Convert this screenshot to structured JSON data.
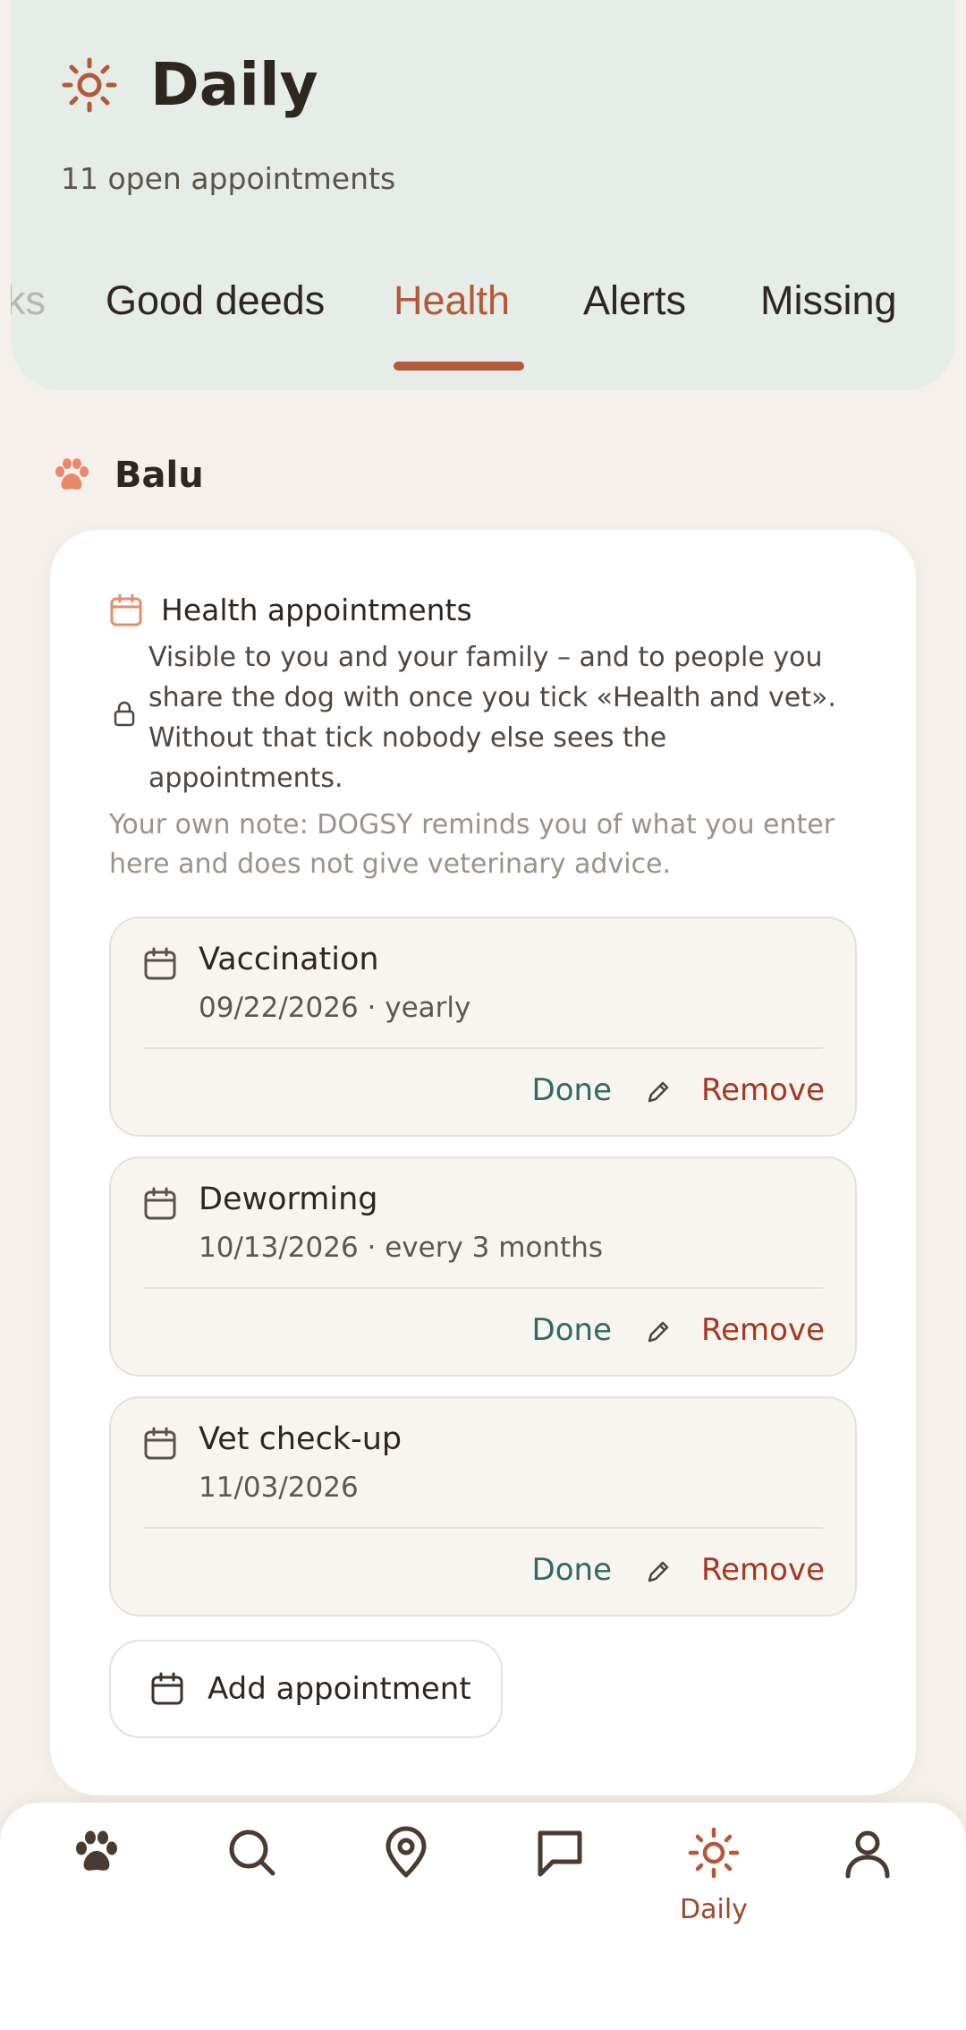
{
  "header": {
    "title": "Daily",
    "subtitle": "11 open appointments"
  },
  "tabs": [
    {
      "label": "ks",
      "state": "faded"
    },
    {
      "label": "Good deeds",
      "state": "normal"
    },
    {
      "label": "Health",
      "state": "active"
    },
    {
      "label": "Alerts",
      "state": "normal"
    },
    {
      "label": "Missing",
      "state": "normal"
    }
  ],
  "dog": {
    "name": "Balu"
  },
  "card": {
    "title": "Health appointments",
    "visibility_text": "Visible to you and your family – and to people you share the dog with once you tick «Health and vet». Without that tick nobody else sees the appointments.",
    "note": "Your own note: DOGSY reminds you of what you enter here and does not give veterinary advice.",
    "appointments": [
      {
        "title": "Vaccination",
        "subtitle": "09/22/2026 · yearly",
        "done_label": "Done",
        "remove_label": "Remove"
      },
      {
        "title": "Deworming",
        "subtitle": "10/13/2026 · every 3 months",
        "done_label": "Done",
        "remove_label": "Remove"
      },
      {
        "title": "Vet check-up",
        "subtitle": "11/03/2026",
        "done_label": "Done",
        "remove_label": "Remove"
      }
    ],
    "add_label": "Add appointment"
  },
  "bottom_nav": {
    "items": [
      {
        "icon": "paw-icon"
      },
      {
        "icon": "search-icon"
      },
      {
        "icon": "map-pin-icon"
      },
      {
        "icon": "chat-icon"
      },
      {
        "icon": "sun-icon",
        "label": "Daily",
        "active": true
      },
      {
        "icon": "profile-icon"
      }
    ]
  },
  "colors": {
    "accent": "#b35a38",
    "done": "#2f6b63",
    "remove": "#a8361e",
    "header_bg": "#e6ece7"
  }
}
